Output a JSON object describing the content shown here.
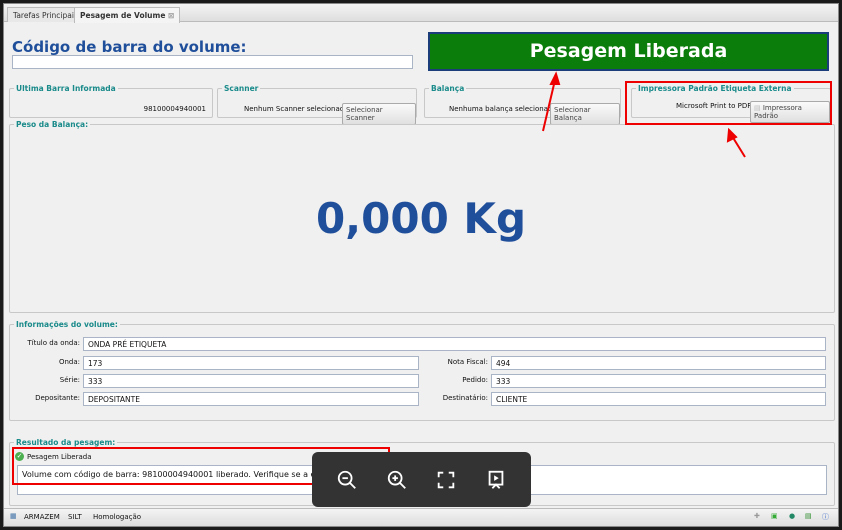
{
  "tabs": [
    {
      "label": "Tarefas Principais"
    },
    {
      "label": "Pesagem de Volume"
    }
  ],
  "barcode": {
    "title": "Código de barra do volume:",
    "value": ""
  },
  "banner": "Pesagem Liberada",
  "ultima": {
    "legend": "Ultima Barra Informada",
    "value": "98100004940001"
  },
  "scanner": {
    "legend": "Scanner",
    "text": "Nenhum Scanner selecionado.",
    "button": "Selecionar Scanner"
  },
  "balanca": {
    "legend": "Balança",
    "text": "Nenhuma balança selecionada.",
    "button": "Selecionar Balança"
  },
  "impressora": {
    "legend": "Impressora Padrão Etiqueta Externa",
    "text": "Microsoft Print to PDF",
    "button": "Impressora Padrão"
  },
  "peso": {
    "legend": "Peso da Balança:",
    "value": "0,000 Kg"
  },
  "info": {
    "legend": "Informações do volume:",
    "titulo_label": "Título da onda:",
    "titulo": "ONDA PRÉ ETIQUETA",
    "onda_label": "Onda:",
    "onda": "173",
    "serie_label": "Série:",
    "serie": "333",
    "depositante_label": "Depositante:",
    "depositante": "DEPOSITANTE",
    "nf_label": "Nota Fiscal:",
    "nf": "494",
    "pedido_label": "Pedido:",
    "pedido": "333",
    "destinatario_label": "Destinatário:",
    "destinatario": "CLIENTE"
  },
  "resultado": {
    "legend": "Resultado da pesagem:",
    "status": "Pesagem Liberada",
    "message": "Volume com código de barra: 98100004940001 liberado. Verifique se a etiqueta de"
  },
  "statusbar": {
    "items": [
      "ARMAZEM",
      "SILT",
      "Homologação"
    ]
  }
}
